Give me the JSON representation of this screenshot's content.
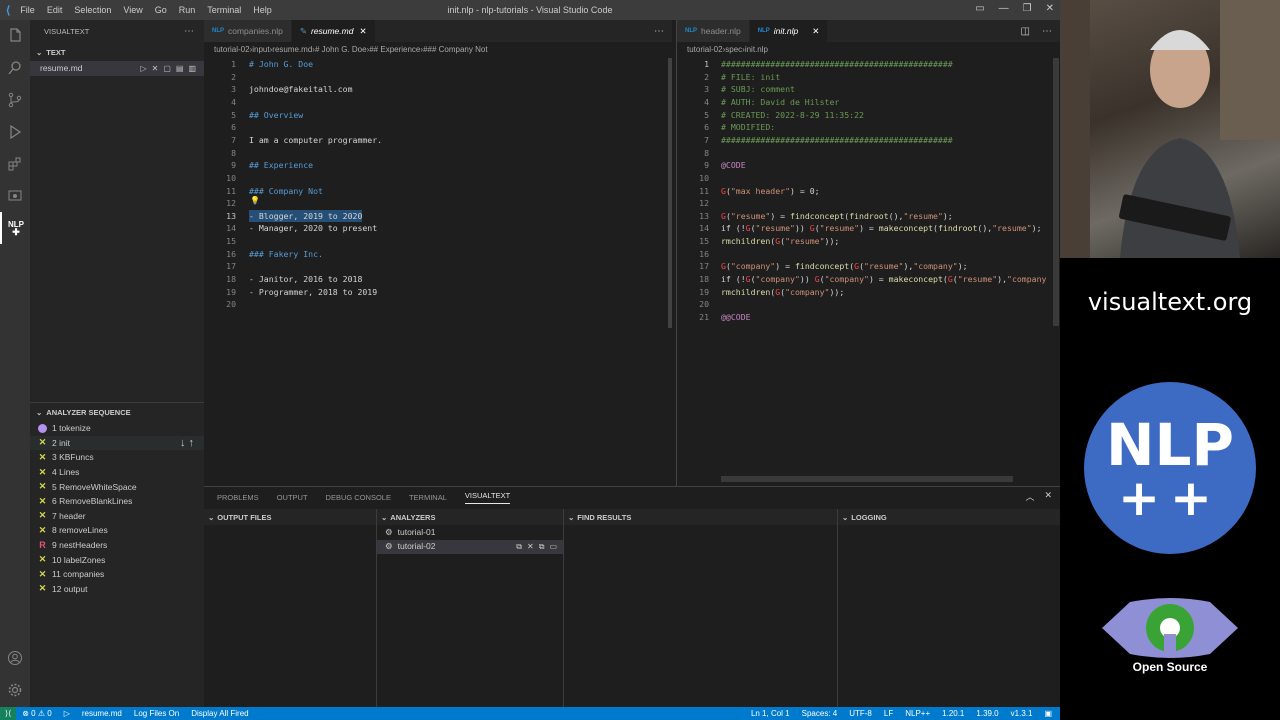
{
  "window": {
    "title": "init.nlp - nlp-tutorials - Visual Studio Code",
    "menu": [
      "File",
      "Edit",
      "Selection",
      "View",
      "Go",
      "Run",
      "Terminal",
      "Help"
    ],
    "controls": [
      "—",
      "❐",
      "✕"
    ]
  },
  "activity": {
    "nlp_label": "NLP"
  },
  "sidebar": {
    "title": "VISUALTEXT",
    "text_header": "TEXT",
    "file": "resume.md",
    "analyzer_header": "ANALYZER SEQUENCE",
    "passes": [
      {
        "label": "1 tokenize",
        "icon": "circle"
      },
      {
        "label": "2 init",
        "icon": "x"
      },
      {
        "label": "3 KBFuncs",
        "icon": "x"
      },
      {
        "label": "4 Lines",
        "icon": "x"
      },
      {
        "label": "5 RemoveWhiteSpace",
        "icon": "x"
      },
      {
        "label": "6 RemoveBlankLines",
        "icon": "x"
      },
      {
        "label": "7 header",
        "icon": "x"
      },
      {
        "label": "8 removeLines",
        "icon": "x"
      },
      {
        "label": "9 nestHeaders",
        "icon": "R"
      },
      {
        "label": "10 labelZones",
        "icon": "x"
      },
      {
        "label": "11 companies",
        "icon": "x"
      },
      {
        "label": "12 output",
        "icon": "x"
      }
    ]
  },
  "left_editor": {
    "tabs": [
      {
        "label": "companies.nlp",
        "badge": "NLP"
      },
      {
        "label": "resume.md",
        "badge": ""
      }
    ],
    "breadcrumbs": [
      "tutorial-02",
      "input",
      "resume.md",
      "# John G. Doe",
      "## Experience",
      "### Company Not"
    ],
    "lines": [
      {
        "n": "1",
        "text": "# John G. Doe",
        "c": "h"
      },
      {
        "n": "2",
        "text": "",
        "c": "w"
      },
      {
        "n": "3",
        "text": "johndoe@fakeitall.com",
        "c": "w"
      },
      {
        "n": "4",
        "text": "",
        "c": "w"
      },
      {
        "n": "5",
        "text": "## Overview",
        "c": "h"
      },
      {
        "n": "6",
        "text": "",
        "c": "w"
      },
      {
        "n": "7",
        "text": "I am a computer programmer.",
        "c": "w"
      },
      {
        "n": "8",
        "text": "",
        "c": "w"
      },
      {
        "n": "9",
        "text": "## Experience",
        "c": "h"
      },
      {
        "n": "10",
        "text": "",
        "c": "w"
      },
      {
        "n": "11",
        "text": "### Company Not",
        "c": "h"
      },
      {
        "n": "12",
        "text": "",
        "c": "w"
      },
      {
        "n": "13",
        "text": "- Blogger, 2019 to 2020",
        "c": "w"
      },
      {
        "n": "14",
        "text": "- Manager, 2020 to present",
        "c": "w"
      },
      {
        "n": "15",
        "text": "",
        "c": "w"
      },
      {
        "n": "16",
        "text": "### Fakery Inc.",
        "c": "h"
      },
      {
        "n": "17",
        "text": "",
        "c": "w"
      },
      {
        "n": "18",
        "text": "- Janitor, 2016 to 2018",
        "c": "w"
      },
      {
        "n": "19",
        "text": "- Programmer, 2018 to 2019",
        "c": "w"
      },
      {
        "n": "20",
        "text": "",
        "c": "w"
      }
    ]
  },
  "right_editor": {
    "tabs": [
      {
        "label": "header.nlp",
        "badge": "NLP"
      },
      {
        "label": "init.nlp",
        "badge": "NLP"
      }
    ],
    "breadcrumbs": [
      "tutorial-02",
      "spec",
      "init.nlp"
    ],
    "lines": [
      {
        "n": "1",
        "segs": [
          {
            "t": "###############################################",
            "c": "g"
          }
        ]
      },
      {
        "n": "2",
        "segs": [
          {
            "t": "# FILE: init",
            "c": "g"
          }
        ]
      },
      {
        "n": "3",
        "segs": [
          {
            "t": "# SUBJ: comment",
            "c": "g"
          }
        ]
      },
      {
        "n": "4",
        "segs": [
          {
            "t": "# AUTH: David de Hilster",
            "c": "g"
          }
        ]
      },
      {
        "n": "5",
        "segs": [
          {
            "t": "# CREATED: 2022-8-29 11:35:22",
            "c": "g"
          }
        ]
      },
      {
        "n": "6",
        "segs": [
          {
            "t": "# MODIFIED:",
            "c": "g"
          }
        ]
      },
      {
        "n": "7",
        "segs": [
          {
            "t": "###############################################",
            "c": "g"
          }
        ]
      },
      {
        "n": "8",
        "segs": []
      },
      {
        "n": "9",
        "segs": [
          {
            "t": "@CODE",
            "c": "m"
          }
        ]
      },
      {
        "n": "10",
        "segs": []
      },
      {
        "n": "11",
        "segs": [
          {
            "t": "G",
            "c": "r"
          },
          {
            "t": "(",
            "c": "w"
          },
          {
            "t": "\"max header\"",
            "c": "s"
          },
          {
            "t": ") = 0;",
            "c": "w"
          }
        ]
      },
      {
        "n": "12",
        "segs": []
      },
      {
        "n": "13",
        "segs": [
          {
            "t": "G",
            "c": "r"
          },
          {
            "t": "(",
            "c": "w"
          },
          {
            "t": "\"resume\"",
            "c": "s"
          },
          {
            "t": ") = ",
            "c": "w"
          },
          {
            "t": "findconcept",
            "c": "y"
          },
          {
            "t": "(",
            "c": "w"
          },
          {
            "t": "findroot",
            "c": "y"
          },
          {
            "t": "(),",
            "c": "w"
          },
          {
            "t": "\"resume\"",
            "c": "s"
          },
          {
            "t": ");",
            "c": "w"
          }
        ]
      },
      {
        "n": "14",
        "segs": [
          {
            "t": "if (!",
            "c": "w"
          },
          {
            "t": "G",
            "c": "r"
          },
          {
            "t": "(",
            "c": "w"
          },
          {
            "t": "\"resume\"",
            "c": "s"
          },
          {
            "t": ")) ",
            "c": "w"
          },
          {
            "t": "G",
            "c": "r"
          },
          {
            "t": "(",
            "c": "w"
          },
          {
            "t": "\"resume\"",
            "c": "s"
          },
          {
            "t": ") = ",
            "c": "w"
          },
          {
            "t": "makeconcept",
            "c": "y"
          },
          {
            "t": "(",
            "c": "w"
          },
          {
            "t": "findroot",
            "c": "y"
          },
          {
            "t": "(),",
            "c": "w"
          },
          {
            "t": "\"resume\"",
            "c": "s"
          },
          {
            "t": ");",
            "c": "w"
          }
        ]
      },
      {
        "n": "15",
        "segs": [
          {
            "t": "rmchildren",
            "c": "y"
          },
          {
            "t": "(",
            "c": "w"
          },
          {
            "t": "G",
            "c": "r"
          },
          {
            "t": "(",
            "c": "w"
          },
          {
            "t": "\"resume\"",
            "c": "s"
          },
          {
            "t": "));",
            "c": "w"
          }
        ]
      },
      {
        "n": "16",
        "segs": []
      },
      {
        "n": "17",
        "segs": [
          {
            "t": "G",
            "c": "r"
          },
          {
            "t": "(",
            "c": "w"
          },
          {
            "t": "\"company\"",
            "c": "s"
          },
          {
            "t": ") = ",
            "c": "w"
          },
          {
            "t": "findconcept",
            "c": "y"
          },
          {
            "t": "(",
            "c": "w"
          },
          {
            "t": "G",
            "c": "r"
          },
          {
            "t": "(",
            "c": "w"
          },
          {
            "t": "\"resume\"",
            "c": "s"
          },
          {
            "t": "),",
            "c": "w"
          },
          {
            "t": "\"company\"",
            "c": "s"
          },
          {
            "t": ");",
            "c": "w"
          }
        ]
      },
      {
        "n": "18",
        "segs": [
          {
            "t": "if (!",
            "c": "w"
          },
          {
            "t": "G",
            "c": "r"
          },
          {
            "t": "(",
            "c": "w"
          },
          {
            "t": "\"company\"",
            "c": "s"
          },
          {
            "t": ")) ",
            "c": "w"
          },
          {
            "t": "G",
            "c": "r"
          },
          {
            "t": "(",
            "c": "w"
          },
          {
            "t": "\"company\"",
            "c": "s"
          },
          {
            "t": ") = ",
            "c": "w"
          },
          {
            "t": "makeconcept",
            "c": "y"
          },
          {
            "t": "(",
            "c": "w"
          },
          {
            "t": "G",
            "c": "r"
          },
          {
            "t": "(",
            "c": "w"
          },
          {
            "t": "\"resume\"",
            "c": "s"
          },
          {
            "t": "),",
            "c": "w"
          },
          {
            "t": "\"company",
            "c": "s"
          }
        ]
      },
      {
        "n": "19",
        "segs": [
          {
            "t": "rmchildren",
            "c": "y"
          },
          {
            "t": "(",
            "c": "w"
          },
          {
            "t": "G",
            "c": "r"
          },
          {
            "t": "(",
            "c": "w"
          },
          {
            "t": "\"company\"",
            "c": "s"
          },
          {
            "t": "));",
            "c": "w"
          }
        ]
      },
      {
        "n": "20",
        "segs": []
      },
      {
        "n": "21",
        "segs": [
          {
            "t": "@@CODE",
            "c": "m"
          }
        ]
      }
    ]
  },
  "panel": {
    "tabs": [
      "PROBLEMS",
      "OUTPUT",
      "DEBUG CONSOLE",
      "TERMINAL",
      "VISUALTEXT"
    ],
    "output_files": "OUTPUT FILES",
    "analyzers": "ANALYZERS",
    "analyzer_items": [
      "tutorial-01",
      "tutorial-02"
    ],
    "find_results": "FIND RESULTS",
    "logging": "LOGGING"
  },
  "statusbar": {
    "problems": "⊗ 0 ⚠ 0",
    "file": "resume.md",
    "log_files": "Log Files On",
    "display": "Display All Fired",
    "position": "Ln 1, Col 1",
    "spaces": "Spaces: 4",
    "encoding": "UTF-8",
    "eol": "LF",
    "lang": "NLP++",
    "v1": "1.20.1",
    "v2": "1.39.0",
    "v3": "v1.3.1"
  },
  "overlay": {
    "site": "visualtext.org",
    "logo_line1": "NLP",
    "logo_line2": "++",
    "open_source": "Open Source"
  },
  "colors": {
    "accent": "#007acc",
    "nlp_logo": "#3d6bc4"
  }
}
